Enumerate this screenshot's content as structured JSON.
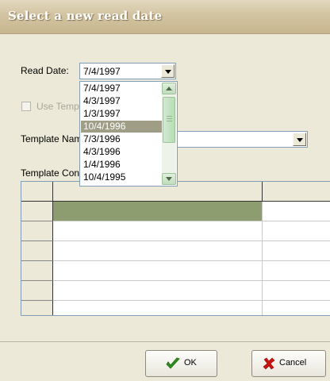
{
  "window": {
    "title": "Select a new read date"
  },
  "read_date": {
    "label": "Read Date:",
    "value": "7/4/1997"
  },
  "use_template": {
    "label": "Use Temp"
  },
  "template_name": {
    "label": "Template Nam",
    "value": ""
  },
  "template_contents": {
    "label": "Template Con"
  },
  "date_list": {
    "options": [
      "7/4/1997",
      "4/3/1997",
      "1/3/1997",
      "10/4/1996",
      "7/3/1996",
      "4/3/1996",
      "1/4/1996",
      "10/4/1995"
    ],
    "selected": "10/4/1996"
  },
  "buttons": {
    "ok_label": "OK",
    "cancel_label": "Cancel"
  },
  "colors": {
    "accent": "#8d9d6f",
    "ok_check": "#2f8f1f",
    "cancel_x": "#cc1111"
  },
  "icons": {
    "ok": "checkmark-icon",
    "cancel": "red-x-icon"
  }
}
